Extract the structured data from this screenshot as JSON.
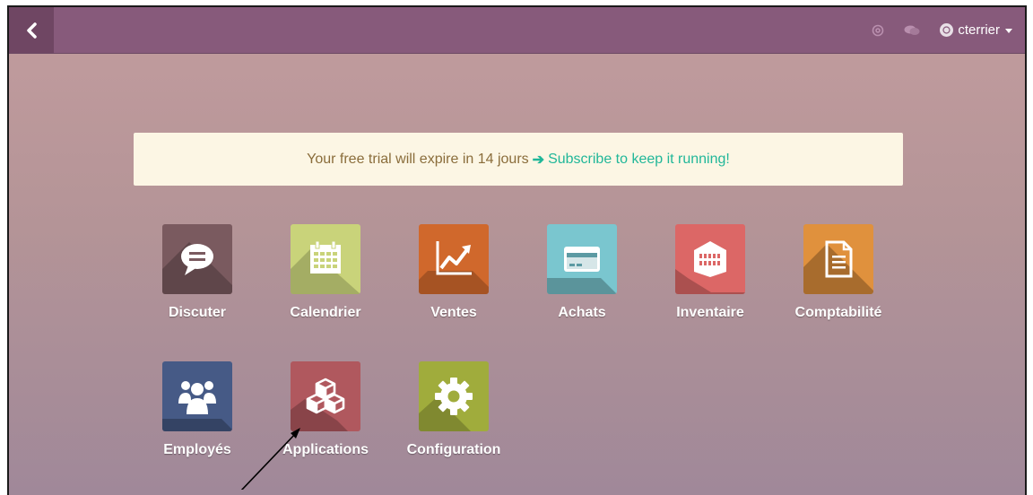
{
  "topbar": {
    "user_name": "cterrier"
  },
  "trial": {
    "text": "Your free trial will expire in 14 jours",
    "arrow": "➔",
    "link": "Subscribe to keep it running!"
  },
  "apps": [
    {
      "label": "Discuter",
      "icon": "chat-icon",
      "color": "#7a5a5f"
    },
    {
      "label": "Calendrier",
      "icon": "calendar-icon",
      "color": "#c9d37a"
    },
    {
      "label": "Ventes",
      "icon": "sales-chart-icon",
      "color": "#d0682c"
    },
    {
      "label": "Achats",
      "icon": "credit-card-icon",
      "color": "#7ac6cf"
    },
    {
      "label": "Inventaire",
      "icon": "warehouse-icon",
      "color": "#dc6766"
    },
    {
      "label": "Comptabilité",
      "icon": "document-icon",
      "color": "#e0913d"
    },
    {
      "label": "Employés",
      "icon": "users-icon",
      "color": "#465a86"
    },
    {
      "label": "Applications",
      "icon": "cubes-icon",
      "color": "#b0585e"
    },
    {
      "label": "Configuration",
      "icon": "gear-icon",
      "color": "#a0ac3c"
    }
  ]
}
